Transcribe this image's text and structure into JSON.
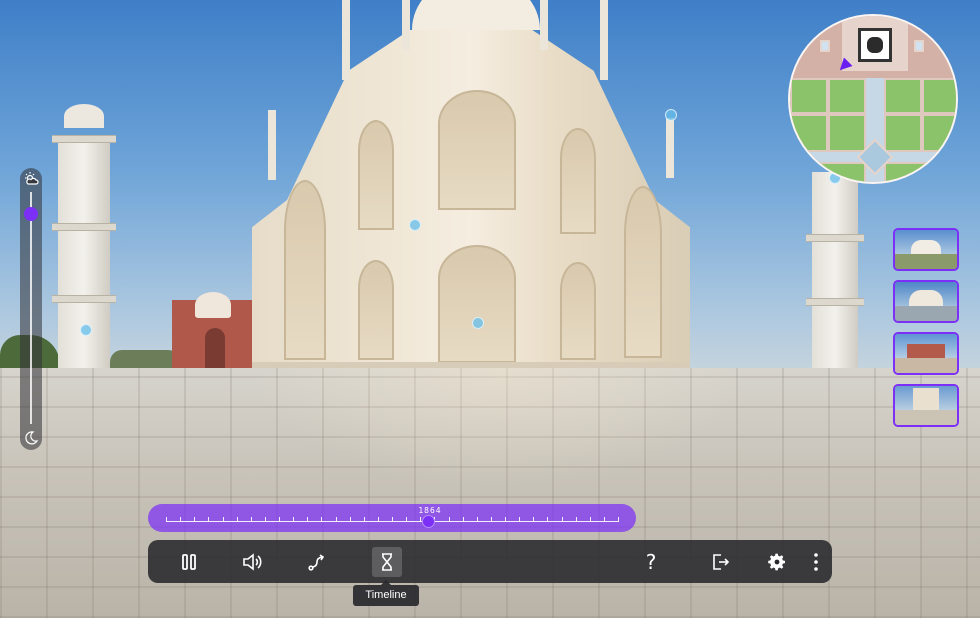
{
  "scene": {
    "description_icon": "panorama-view",
    "hotspot_color": "#64bee6"
  },
  "time_of_day": {
    "top_icon": "cloud-sun-icon",
    "bottom_icon": "moon-icon",
    "level": 0.2
  },
  "minimap": {
    "position_marker_color": "#6a1ff2"
  },
  "thumbnails": {
    "border_color": "#7b2ff7",
    "items": [
      {
        "icon": "taj-front-view"
      },
      {
        "icon": "taj-side-view"
      },
      {
        "icon": "mosque-view"
      },
      {
        "icon": "platform-view"
      }
    ]
  },
  "timeline": {
    "year_label": "1864",
    "position": 0.58,
    "color": "#7b2ff7"
  },
  "controls": {
    "pause_icon": "pause-icon",
    "volume_icon": "volume-icon",
    "route_icon": "route-icon",
    "timeline_icon": "hourglass-icon",
    "help_label": "?",
    "exit_icon": "exit-icon",
    "settings_icon": "gear-icon",
    "more_icon": "more-vertical-icon",
    "tooltip": "Timeline"
  }
}
